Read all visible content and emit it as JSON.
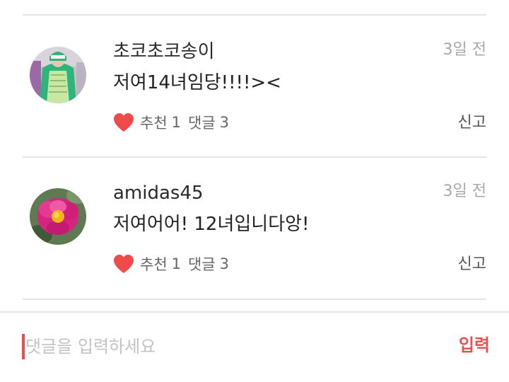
{
  "comments": [
    {
      "author": "초코초코송이",
      "time": "3일 전",
      "text": "저여14녀임당!!!!><",
      "recommend_label": "추천",
      "recommend_count": "1",
      "reply_label": "댓글",
      "reply_count": "3",
      "report_label": "신고",
      "avatar_icon": "avatar-photo-dinosaur-costume"
    },
    {
      "author": "amidas45",
      "time": "3일 전",
      "text": "저여어어! 12녀입니다앙!",
      "recommend_label": "추천",
      "recommend_count": "1",
      "reply_label": "댓글",
      "reply_count": "3",
      "report_label": "신고",
      "avatar_icon": "avatar-photo-pink-flower"
    }
  ],
  "input_bar": {
    "placeholder": "댓글을 입력하세요",
    "submit_label": "입력"
  },
  "colors": {
    "heart": "#f04b4b",
    "accent": "#e65050",
    "divider": "#e4e4e4",
    "muted_text": "#a8a8a8"
  }
}
